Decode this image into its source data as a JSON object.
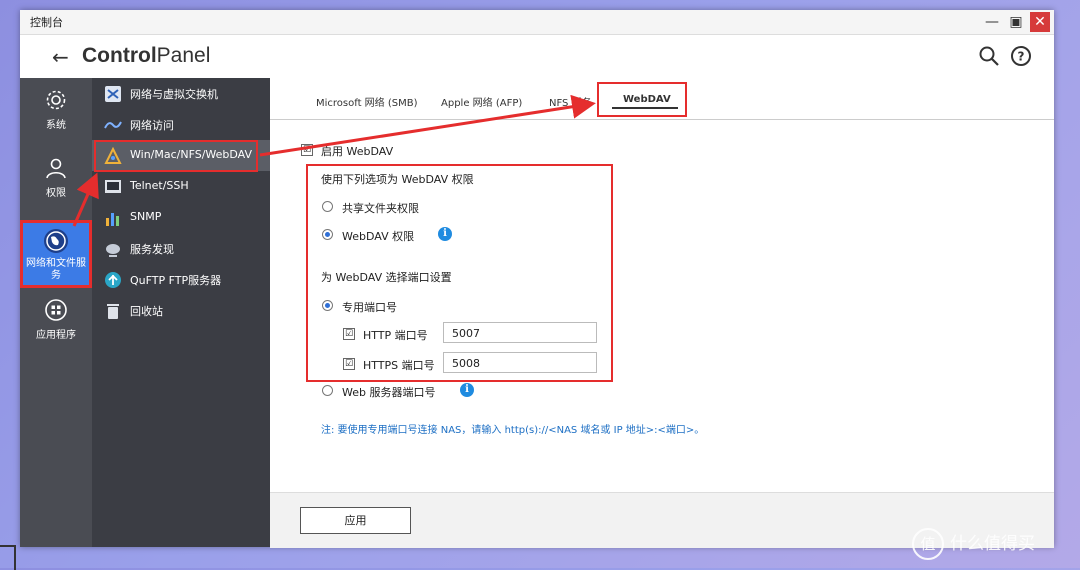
{
  "window": {
    "title": "控制台"
  },
  "header": {
    "brand_bold": "Control",
    "brand_light": "Panel"
  },
  "leftnav": [
    {
      "label": "系统"
    },
    {
      "label": "权限"
    },
    {
      "label": "网络和文件服务"
    },
    {
      "label": "应用程序"
    }
  ],
  "subnav": [
    {
      "label": "网络与虚拟交换机"
    },
    {
      "label": "网络访问"
    },
    {
      "label": "Win/Mac/NFS/WebDAV"
    },
    {
      "label": "Telnet/SSH"
    },
    {
      "label": "SNMP"
    },
    {
      "label": "服务发现"
    },
    {
      "label": "QuFTP FTP服务器"
    },
    {
      "label": "回收站"
    }
  ],
  "tabs": [
    {
      "label": "Microsoft 网络 (SMB)"
    },
    {
      "label": "Apple 网络 (AFP)"
    },
    {
      "label": "NFS 服务"
    },
    {
      "label": "WebDAV"
    }
  ],
  "form": {
    "enable_label": "启用 WebDAV",
    "enable_checked": "☑",
    "perm_heading": "使用下列选项为 WebDAV 权限",
    "perm_share": "共享文件夹权限",
    "perm_webdav": "WebDAV 权限",
    "port_heading": "为 WebDAV 选择端口设置",
    "port_dedicated": "专用端口号",
    "http_label": "HTTP 端口号",
    "http_value": "5007",
    "https_label": "HTTPS 端口号",
    "https_value": "5008",
    "port_web": "Web 服务器端口号",
    "note": "注: 要使用专用端口号连接 NAS，请输入 http(s)://<NAS 域名或 IP 地址>:<端口>。",
    "checkmark": "☑"
  },
  "apply_label": "应用",
  "info_glyph": "i",
  "watermark": {
    "logo": "值",
    "text": "什么值得买"
  },
  "colors": {
    "accent": "#3c7be6",
    "highlight": "#e52d2d",
    "note": "#1d6fc4"
  }
}
